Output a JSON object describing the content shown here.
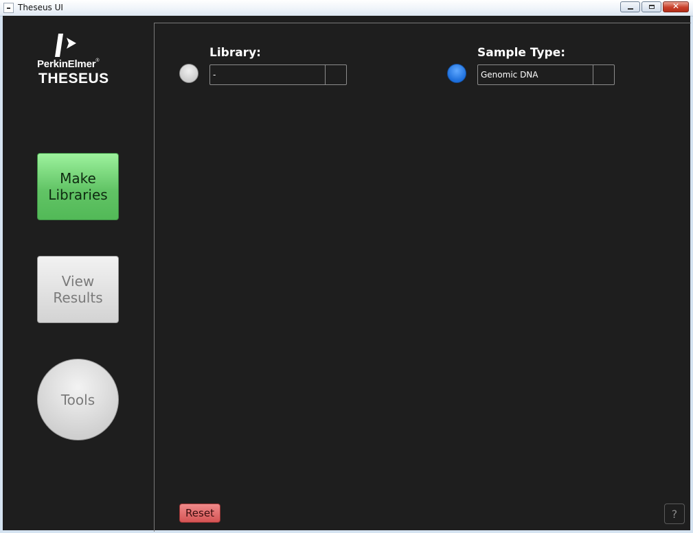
{
  "window": {
    "title": "Theseus UI",
    "icons": {
      "app": "app-icon",
      "minimize": "minimize-icon",
      "restore": "restore-icon",
      "close": "close-icon"
    }
  },
  "logo": {
    "brand": "PerkinElmer",
    "brand_mark": "®",
    "product": "THESEUS"
  },
  "nav": {
    "make_libraries": "Make\nLibraries",
    "view_results": "View\nResults",
    "tools": "Tools"
  },
  "fields": {
    "library": {
      "label": "Library:",
      "value": "-",
      "status_color": "#d8d8d8"
    },
    "sample_type": {
      "label": "Sample Type:",
      "value": "Genomic DNA",
      "status_color": "#2a7de6"
    }
  },
  "footer": {
    "reset": "Reset",
    "help": "?"
  },
  "colors": {
    "background": "#1e1e1e",
    "make_button": "#62c466",
    "reset_button": "#e06666"
  }
}
